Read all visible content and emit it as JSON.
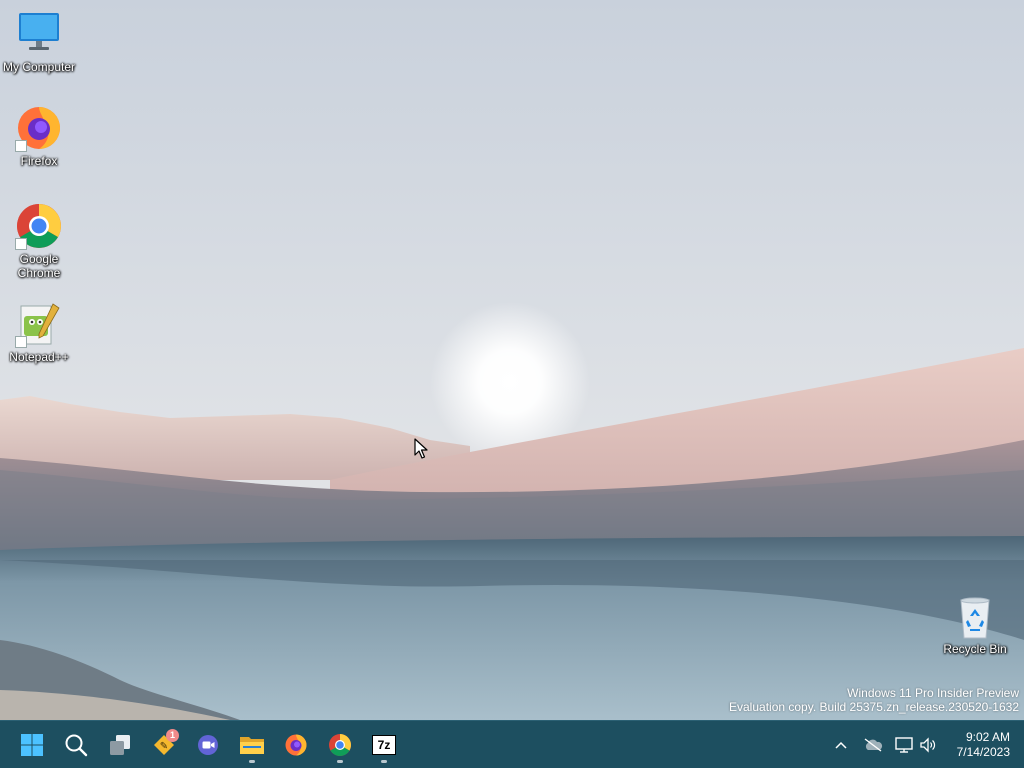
{
  "desktop": {
    "icons": [
      {
        "label": "My Computer"
      },
      {
        "label": "Firefox"
      },
      {
        "label": "Google\nChrome"
      },
      {
        "label": "Notepad++"
      },
      {
        "label": "Recycle Bin"
      }
    ],
    "watermark": {
      "line1": "Windows 11 Pro Insider Preview",
      "line2": "Evaluation copy. Build 25375.zn_release.230520-1632"
    }
  },
  "taskbar": {
    "pinned": [
      {
        "icon": "windows-start-icon"
      },
      {
        "icon": "search-icon"
      },
      {
        "icon": "task-view-icon"
      },
      {
        "icon": "ticket-app-icon",
        "badge": "1"
      },
      {
        "icon": "teams-chat-icon"
      },
      {
        "icon": "file-explorer-icon",
        "running": true
      },
      {
        "icon": "firefox-icon"
      },
      {
        "icon": "chrome-icon",
        "running": true
      },
      {
        "icon": "7zip-icon",
        "running": true,
        "label": "7z"
      }
    ],
    "tray": {
      "icons": [
        "chevron-up-icon",
        "onedrive-offline-icon",
        "network-icon",
        "volume-icon"
      ],
      "time": "9:02 AM",
      "date": "7/14/2023"
    }
  }
}
